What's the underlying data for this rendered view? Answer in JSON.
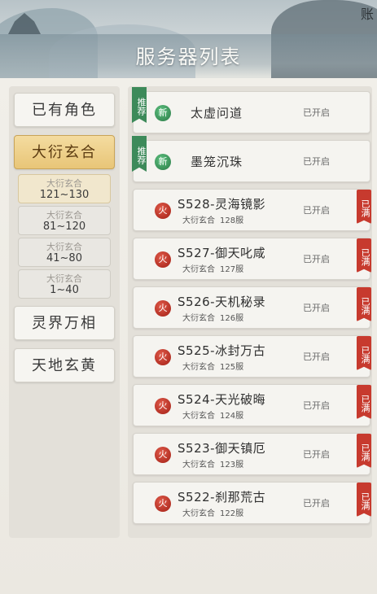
{
  "header": {
    "title": "服务器列表",
    "corner_text": "账"
  },
  "categories": [
    {
      "label": "已有角色",
      "active": false
    },
    {
      "label": "大衍玄合",
      "active": true
    },
    {
      "label": "灵界万相",
      "active": false
    },
    {
      "label": "天地玄黄",
      "active": false
    }
  ],
  "sub_ranges": [
    {
      "group": "大衍玄合",
      "range": "121~130",
      "active": true
    },
    {
      "group": "大衍玄合",
      "range": "81~120",
      "active": false
    },
    {
      "group": "大衍玄合",
      "range": "41~80",
      "active": false
    },
    {
      "group": "大衍玄合",
      "range": "1~40",
      "active": false
    }
  ],
  "servers": [
    {
      "tag": "推荐",
      "status": "新",
      "name": "太虚问道",
      "state": "已开启"
    },
    {
      "tag": "推荐",
      "status": "新",
      "name": "墨笼沉珠",
      "state": "已开启"
    },
    {
      "status": "火",
      "name": "S528-灵海镜影",
      "group": "大衍玄合",
      "num": "128服",
      "state": "已开启",
      "full": "已满"
    },
    {
      "status": "火",
      "name": "S527-御天叱咸",
      "group": "大衍玄合",
      "num": "127服",
      "state": "已开启",
      "full": "已满"
    },
    {
      "status": "火",
      "name": "S526-天机秘录",
      "group": "大衍玄合",
      "num": "126服",
      "state": "已开启",
      "full": "已满"
    },
    {
      "status": "火",
      "name": "S525-冰封万古",
      "group": "大衍玄合",
      "num": "125服",
      "state": "已开启",
      "full": "已满"
    },
    {
      "status": "火",
      "name": "S524-天光破晦",
      "group": "大衍玄合",
      "num": "124服",
      "state": "已开启",
      "full": "已满"
    },
    {
      "status": "火",
      "name": "S523-御天镇厄",
      "group": "大衍玄合",
      "num": "123服",
      "state": "已开启",
      "full": "已满"
    },
    {
      "status": "火",
      "name": "S522-刹那荒古",
      "group": "大衍玄合",
      "num": "122服",
      "state": "已开启",
      "full": "已满"
    }
  ],
  "colors": {
    "accent_gold": "#e8c578",
    "full_red": "#c73a2e",
    "recommend_green": "#3d8a5a"
  }
}
